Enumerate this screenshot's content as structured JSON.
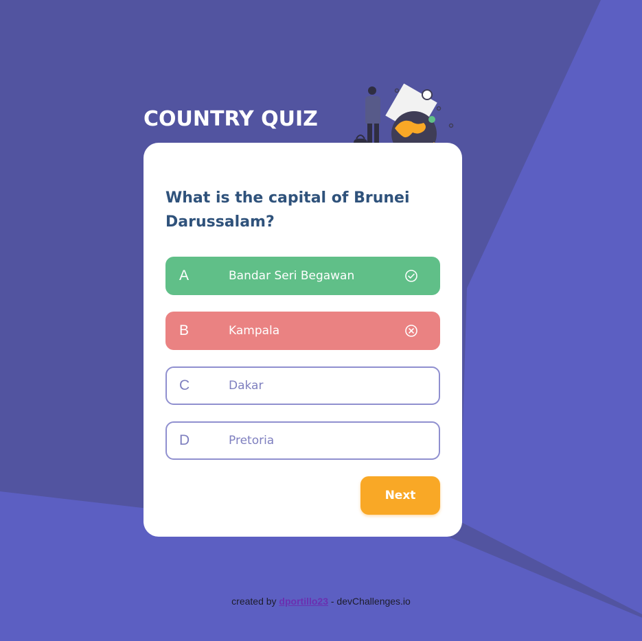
{
  "app": {
    "title": "COUNTRY QUIZ"
  },
  "quiz": {
    "question": "What is the capital of Brunei Darussalam?",
    "options": [
      {
        "letter": "A",
        "text": "Bandar Seri Begawan",
        "state": "correct",
        "icon": "check-circle-icon"
      },
      {
        "letter": "B",
        "text": "Kampala",
        "state": "wrong",
        "icon": "x-circle-icon"
      },
      {
        "letter": "C",
        "text": "Dakar",
        "state": "neutral",
        "icon": ""
      },
      {
        "letter": "D",
        "text": "Pretoria",
        "state": "neutral",
        "icon": ""
      }
    ],
    "next_label": "Next"
  },
  "footer": {
    "prefix": "created by",
    "author": "dportillo23",
    "suffix": "- devChallenges.io"
  },
  "colors": {
    "background": "#5254a0",
    "correct": "#60bf88",
    "wrong": "#ea8282",
    "accent": "#f9a826",
    "question_text": "#2f527b"
  }
}
